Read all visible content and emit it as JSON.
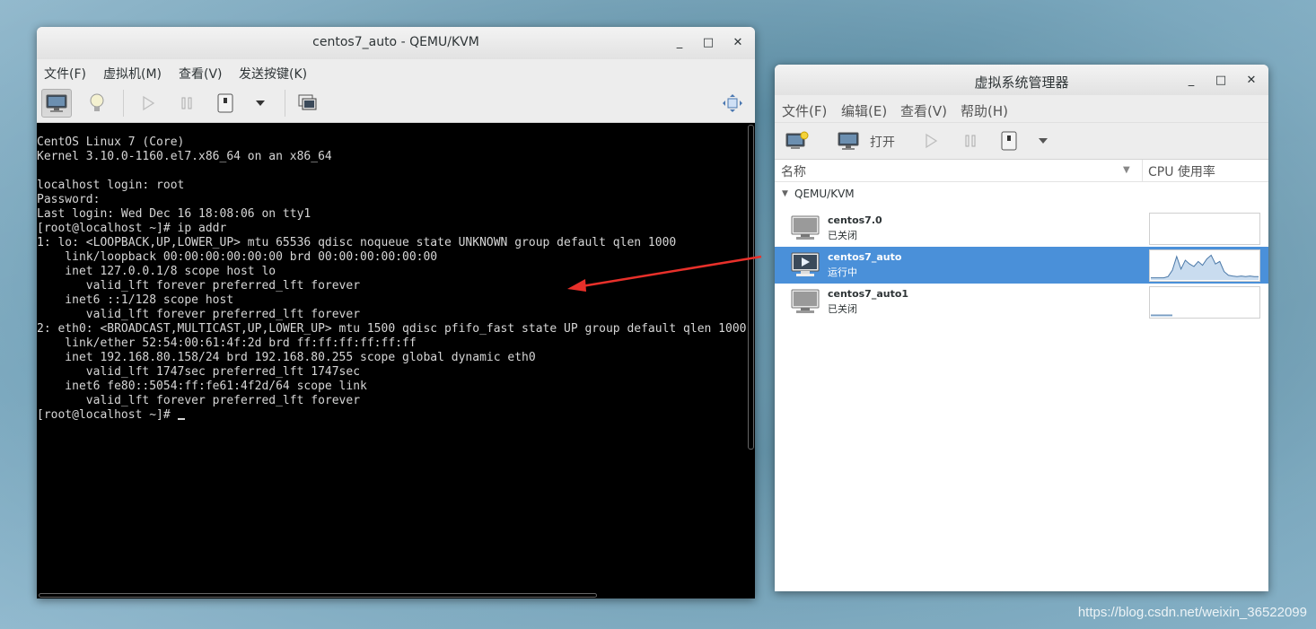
{
  "colors": {
    "selection": "#4a90d9",
    "arrow": "#e8302a",
    "console_bg": "#000000",
    "console_text": "#d6d6d6"
  },
  "qemu": {
    "title": "centos7_auto - QEMU/KVM",
    "window_buttons": {
      "minimize": "_",
      "maximize": "□",
      "close": "✕"
    },
    "menu": [
      "文件(F)",
      "虚拟机(M)",
      "查看(V)",
      "发送按键(K)"
    ],
    "toolbar_icons": [
      "monitor-icon",
      "lightbulb-icon",
      "play-icon",
      "pause-icon",
      "power-icon",
      "dropdown-icon",
      "screenshot-icon",
      "fullscreen-icon"
    ],
    "console_lines": [
      "CentOS Linux 7 (Core)",
      "Kernel 3.10.0-1160.el7.x86_64 on an x86_64",
      "",
      "localhost login: root",
      "Password:",
      "Last login: Wed Dec 16 18:08:06 on tty1",
      "[root@localhost ~]# ip addr",
      "1: lo: <LOOPBACK,UP,LOWER_UP> mtu 65536 qdisc noqueue state UNKNOWN group default qlen 1000",
      "    link/loopback 00:00:00:00:00:00 brd 00:00:00:00:00:00",
      "    inet 127.0.0.1/8 scope host lo",
      "       valid_lft forever preferred_lft forever",
      "    inet6 ::1/128 scope host",
      "       valid_lft forever preferred_lft forever",
      "2: eth0: <BROADCAST,MULTICAST,UP,LOWER_UP> mtu 1500 qdisc pfifo_fast state UP group default qlen 1000",
      "    link/ether 52:54:00:61:4f:2d brd ff:ff:ff:ff:ff:ff",
      "    inet 192.168.80.158/24 brd 192.168.80.255 scope global dynamic eth0",
      "       valid_lft 1747sec preferred_lft 1747sec",
      "    inet6 fe80::5054:ff:fe61:4f2d/64 scope link",
      "       valid_lft forever preferred_lft forever"
    ],
    "prompt": "[root@localhost ~]# "
  },
  "vmm": {
    "title": "虚拟系统管理器",
    "window_buttons": {
      "minimize": "_",
      "maximize": "□",
      "close": "✕"
    },
    "menu": [
      "文件(F)",
      "编辑(E)",
      "查看(V)",
      "帮助(H)"
    ],
    "toolbar": {
      "open_label": "打开"
    },
    "columns": {
      "name": "名称",
      "cpu": "CPU 使用率"
    },
    "group": "QEMU/KVM",
    "vms": [
      {
        "name": "centos7.0",
        "status": "已关闭",
        "selected": false,
        "cpu_history": []
      },
      {
        "name": "centos7_auto",
        "status": "运行中",
        "selected": true,
        "cpu_history": [
          0.05,
          0.05,
          0.05,
          0.05,
          0.1,
          0.35,
          0.9,
          0.4,
          0.75,
          0.6,
          0.5,
          0.7,
          0.55,
          0.8,
          0.95,
          0.6,
          0.7,
          0.3,
          0.15,
          0.12,
          0.1,
          0.12,
          0.1,
          0.12,
          0.1,
          0.1
        ]
      },
      {
        "name": "centos7_auto1",
        "status": "已关闭",
        "selected": false,
        "cpu_history": [
          0.03,
          0.03,
          0.03,
          0.03,
          0.03,
          0.03
        ]
      }
    ]
  },
  "watermark": "https://blog.csdn.net/weixin_36522099"
}
